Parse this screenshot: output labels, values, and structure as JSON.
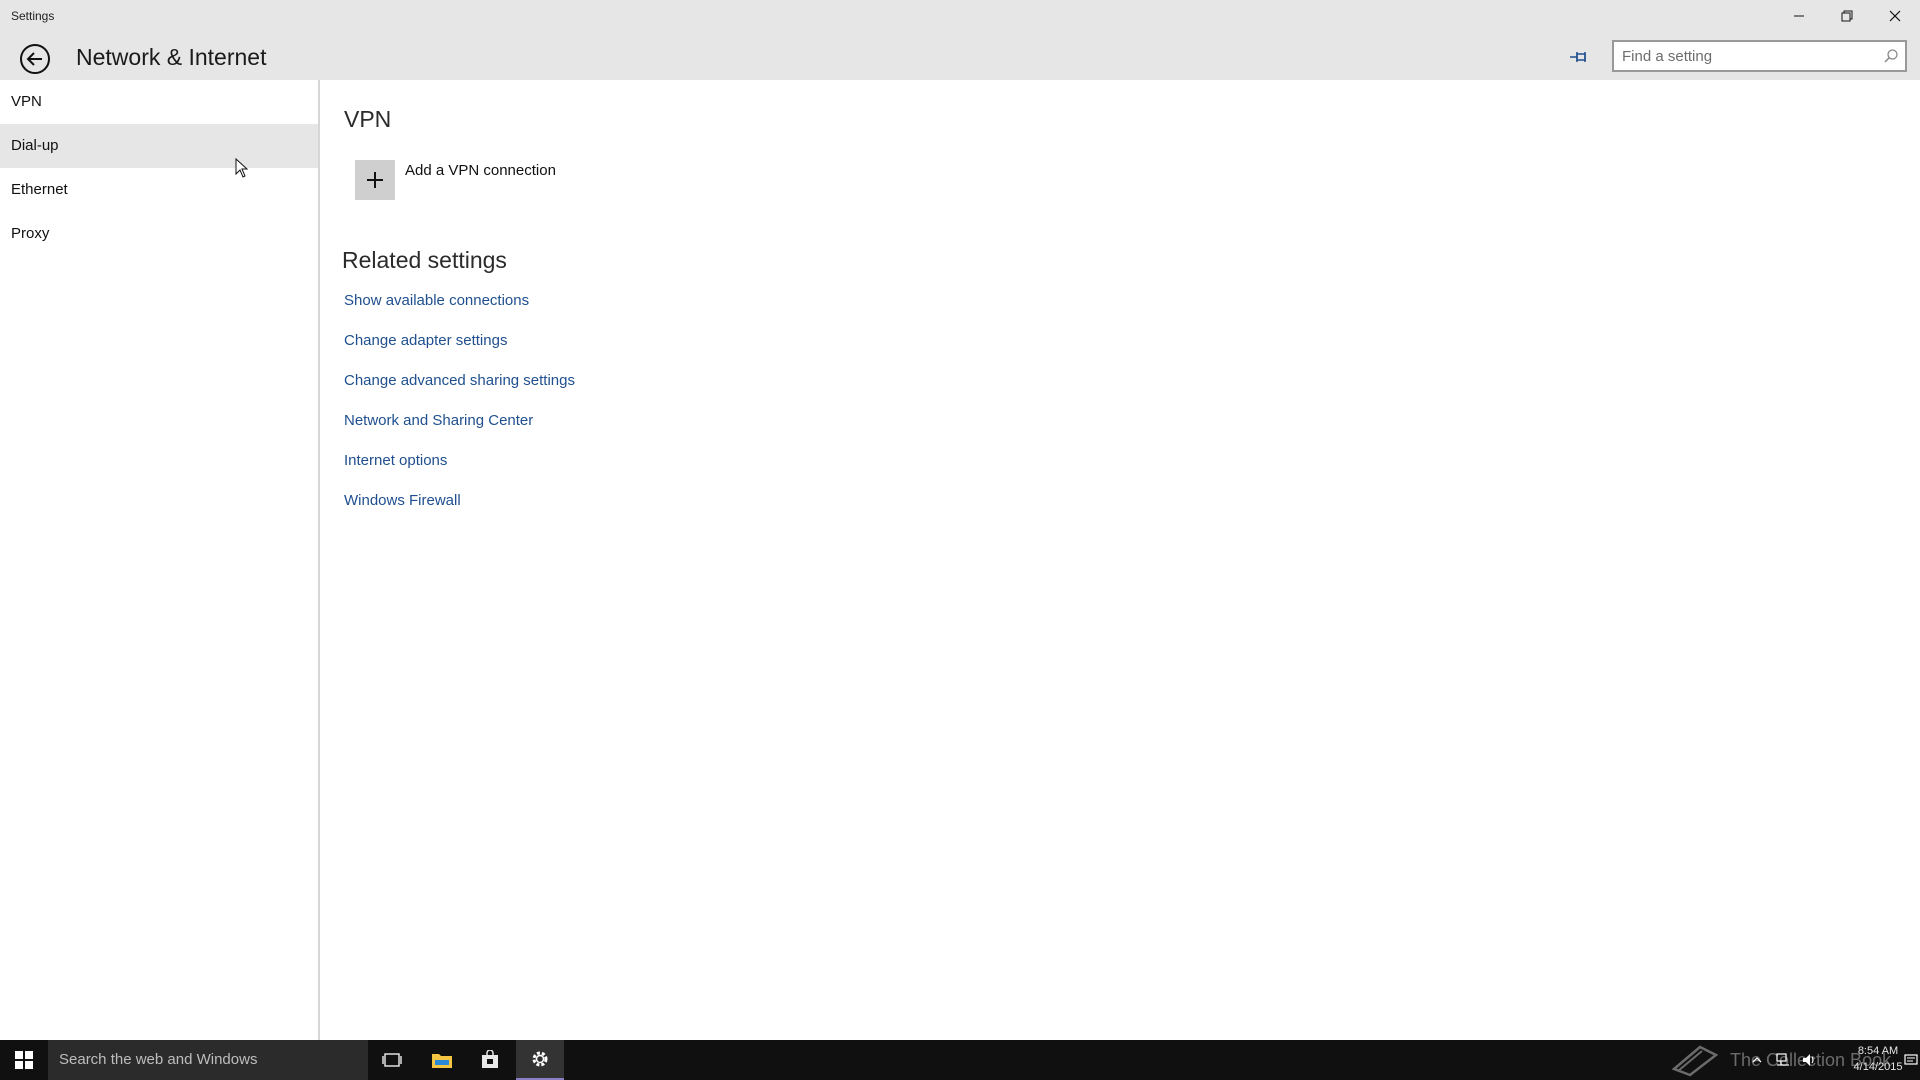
{
  "window": {
    "app_title": "Settings"
  },
  "header": {
    "page_title": "Network & Internet",
    "search_placeholder": "Find a setting"
  },
  "sidebar": {
    "items": [
      {
        "label": "VPN"
      },
      {
        "label": "Dial-up",
        "hover": true
      },
      {
        "label": "Ethernet"
      },
      {
        "label": "Proxy"
      }
    ]
  },
  "content": {
    "section_title": "VPN",
    "add_vpn_label": "Add a VPN connection",
    "related_title": "Related settings",
    "related_links": [
      "Show available connections",
      "Change adapter settings",
      "Change advanced sharing settings",
      "Network and Sharing Center",
      "Internet options",
      "Windows Firewall"
    ]
  },
  "taskbar": {
    "search_placeholder": "Search the web and Windows",
    "watermark": "The Collection Book",
    "clock_time": "8:54 AM",
    "clock_date": "4/14/2015"
  },
  "colors": {
    "header_bg": "#e6e6e6",
    "link": "#1f4f8f",
    "taskbar_bg": "#101010",
    "active_app_underline": "#8a7fc4"
  },
  "icons": [
    "back-icon",
    "minimize-icon",
    "restore-icon",
    "close-icon",
    "pin-icon",
    "search-icon",
    "plus-icon",
    "windows-logo-icon",
    "task-view-icon",
    "file-explorer-icon",
    "store-icon",
    "settings-gear-icon",
    "book-icon",
    "chevron-up-icon",
    "network-icon",
    "volume-icon",
    "action-center-icon"
  ]
}
